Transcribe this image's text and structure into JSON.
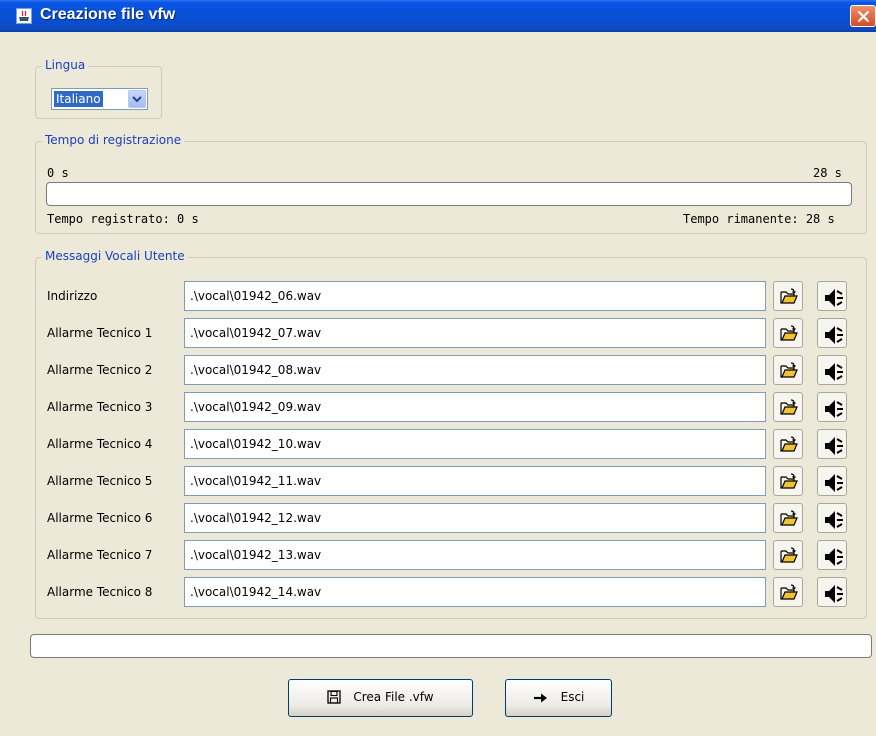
{
  "window": {
    "title": "Creazione file vfw",
    "close_label": "close"
  },
  "language": {
    "legend": "Lingua",
    "selected": "Italiano"
  },
  "recording": {
    "legend": "Tempo di registrazione",
    "min_label": "0 s",
    "max_label": "28 s",
    "progress": 0,
    "recorded_label": "Tempo registrato: 0 s",
    "remaining_label": "Tempo rimanente: 28 s"
  },
  "messages": {
    "legend": "Messaggi Vocali Utente",
    "rows": [
      {
        "label": "Indirizzo",
        "file": ".\\vocal\\01942_06.wav"
      },
      {
        "label": "Allarme Tecnico 1",
        "file": ".\\vocal\\01942_07.wav"
      },
      {
        "label": "Allarme Tecnico 2",
        "file": ".\\vocal\\01942_08.wav"
      },
      {
        "label": "Allarme Tecnico 3",
        "file": ".\\vocal\\01942_09.wav"
      },
      {
        "label": "Allarme Tecnico 4",
        "file": ".\\vocal\\01942_10.wav"
      },
      {
        "label": "Allarme Tecnico 5",
        "file": ".\\vocal\\01942_11.wav"
      },
      {
        "label": "Allarme Tecnico 6",
        "file": ".\\vocal\\01942_12.wav"
      },
      {
        "label": "Allarme Tecnico 7",
        "file": ".\\vocal\\01942_13.wav"
      },
      {
        "label": "Allarme Tecnico 8",
        "file": ".\\vocal\\01942_14.wav"
      }
    ],
    "open_icon": "folder-open-icon",
    "play_icon": "speaker-icon"
  },
  "status": {
    "progress": 0
  },
  "actions": {
    "create_label": "Crea File .vfw",
    "create_icon": "floppy-disk-icon",
    "exit_label": "Esci",
    "exit_icon": "arrow-right-icon"
  },
  "colors": {
    "titlebar": "#0a4fd0",
    "legend_text": "#1a3fbf",
    "window_bg": "#ece9d8",
    "selection": "#316ac5"
  }
}
